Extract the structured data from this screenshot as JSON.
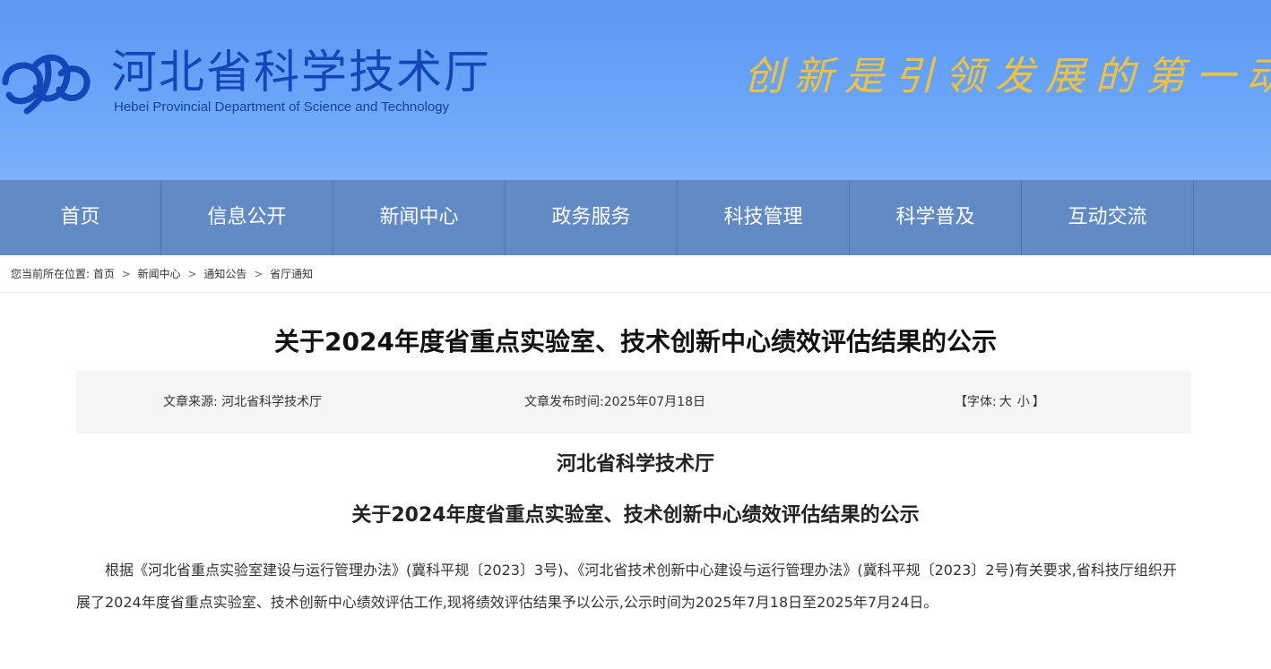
{
  "header": {
    "title": "河北省科学技术厅",
    "subtitle": "Hebei Provincial Department of Science and Technology",
    "slogan": "创新是引领发展的第一动力",
    "logo_icon": "hebei-science-logo-icon",
    "colors": {
      "banner": "#6aa5f8",
      "title": "#1546b8",
      "slogan": "#f2c23e"
    }
  },
  "nav": {
    "items": [
      {
        "label": "首页"
      },
      {
        "label": "信息公开"
      },
      {
        "label": "新闻中心"
      },
      {
        "label": "政务服务"
      },
      {
        "label": "科技管理"
      },
      {
        "label": "科学普及"
      },
      {
        "label": "互动交流"
      }
    ],
    "color": "#628ac4"
  },
  "breadcrumb": {
    "prefix": "您当前所在位置:",
    "items": [
      "首页",
      "新闻中心",
      "通知公告",
      "省厅通知"
    ],
    "separator": ">"
  },
  "article": {
    "title": "关于2024年度省重点实验室、技术创新中心绩效评估结果的公示",
    "meta": {
      "source": "文章来源: 河北省科学技术厅",
      "date": "文章发布时间:2025年07月18日",
      "font_prefix": "【字体:",
      "font_large": "大",
      "font_small": "小",
      "font_suffix": "】"
    },
    "org": "河北省科学技术厅",
    "doc_title": "关于2024年度省重点实验室、技术创新中心绩效评估结果的公示",
    "body": "根据《河北省重点实验室建设与运行管理办法》(冀科平规〔2023〕3号)、《河北省技术创新中心建设与运行管理办法》(冀科平规〔2023〕2号)有关要求,省科技厅组织开展了2024年度省重点实验室、技术创新中心绩效评估工作,现将绩效评估结果予以公示,公示时间为2025年7月18日至2025年7月24日。"
  }
}
